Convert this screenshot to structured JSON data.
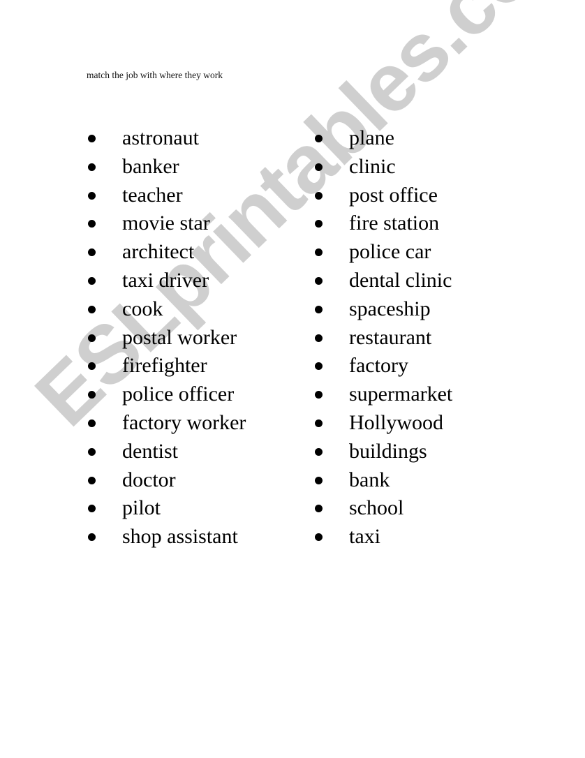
{
  "worksheet": {
    "instruction": "match the job with where they work",
    "watermark": "ESLprintables.com",
    "jobs": [
      "astronaut",
      "banker",
      "teacher",
      "movie star",
      "architect",
      "taxi driver",
      "cook",
      "postal worker",
      "firefighter",
      "police officer",
      "factory worker",
      "dentist",
      "doctor",
      "pilot",
      "shop assistant"
    ],
    "places": [
      "plane",
      "clinic",
      "post office",
      "fire station",
      "police car",
      "dental clinic",
      "spaceship",
      "restaurant",
      "factory",
      "supermarket",
      "Hollywood",
      "buildings",
      "bank",
      "school",
      "taxi"
    ]
  }
}
